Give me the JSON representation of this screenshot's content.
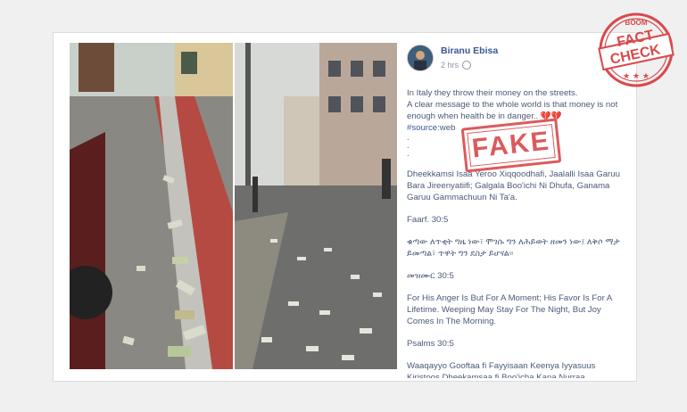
{
  "post": {
    "author": "Biranu Ebisa",
    "time": "2 hrs",
    "paragraphs": {
      "p1_line1": "In Italy they throw their money on the streets.",
      "p1_line2": "A clear message to the whole world is that money is not enough when health be in danger..",
      "hearts": "💔💔",
      "hashtag": "#source",
      "hashtag_tail": ":web",
      "p2": "Dheekkamsi Isaa Yeroo Xiqqoodhafi, Jaalalli Isaa Garuu Bara Jireenyatiifi; Galgala Boo'ichi Ni Dhufa, Ganama Garuu Gammachuun Ni Ta'a.",
      "ref1": "Faarf. 30:5",
      "p3": "ቁጣው ለጥቂት ግዜ ነው፣ ሞገሱ ግን ለሕይወት ዘመን ነው፤ ለቅሶ ማታ ይመጣል፣ ጥዋት ግን ደስታ ይሆናል።",
      "ref2": "መዝሙር 30:5",
      "p4": "For His Anger Is But For A Moment; His Favor Is For A Lifetime. Weeping May Stay For The Night, But Joy Comes In The Morning.",
      "ref3": "Psalms 30:5",
      "p5": "Waaqayyo Gooftaa fi Fayyisaan Keenya Iyyasuus Kiristoos Dheekamsaa fi Boo'icha Kana Nurraa"
    }
  },
  "stamps": {
    "fake": "FAKE",
    "badge_top": "BOOM",
    "badge_line1": "FACT",
    "badge_line2": "CHECK",
    "badge_stars": "★ ★ ★"
  },
  "colors": {
    "accent": "#385898",
    "stamp_red": "#d9494b"
  }
}
